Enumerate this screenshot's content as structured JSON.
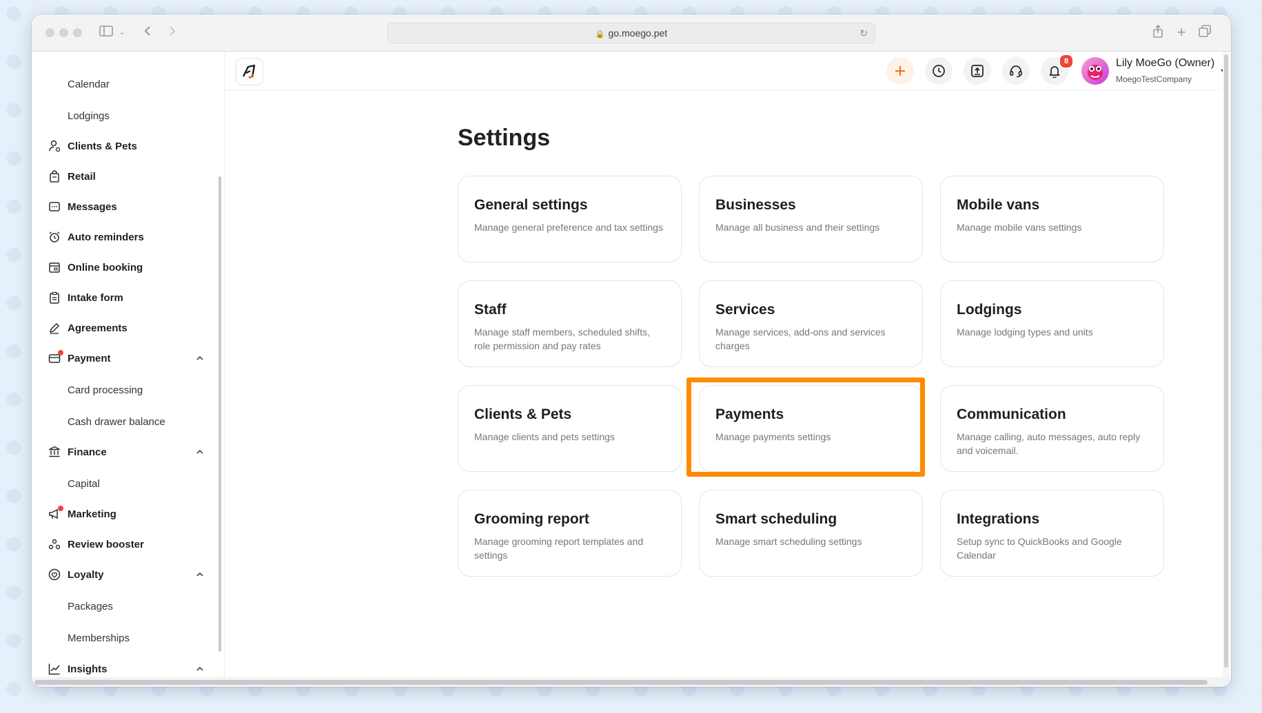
{
  "browser": {
    "url": "go.moego.pet"
  },
  "sidebar": {
    "items": [
      {
        "label": "Calendar",
        "sub": true
      },
      {
        "label": "Lodgings",
        "sub": true
      },
      {
        "label": "Clients & Pets",
        "icon": "user-icon"
      },
      {
        "label": "Retail",
        "icon": "bag-icon"
      },
      {
        "label": "Messages",
        "icon": "message-icon"
      },
      {
        "label": "Auto reminders",
        "icon": "alarm-clock-icon"
      },
      {
        "label": "Online booking",
        "icon": "calendar-booking-icon"
      },
      {
        "label": "Intake form",
        "icon": "clipboard-icon"
      },
      {
        "label": "Agreements",
        "icon": "pen-icon"
      },
      {
        "label": "Payment",
        "icon": "payment-icon",
        "expanded": true
      },
      {
        "label": "Card processing",
        "sub": true
      },
      {
        "label": "Cash drawer balance",
        "sub": true
      },
      {
        "label": "Finance",
        "icon": "bank-icon",
        "expanded": true
      },
      {
        "label": "Capital",
        "sub": true
      },
      {
        "label": "Marketing",
        "icon": "megaphone-icon"
      },
      {
        "label": "Review booster",
        "icon": "review-icon"
      },
      {
        "label": "Loyalty",
        "icon": "loyalty-icon",
        "expanded": true
      },
      {
        "label": "Packages",
        "sub": true
      },
      {
        "label": "Memberships",
        "sub": true
      },
      {
        "label": "Insights",
        "icon": "chart-icon",
        "expanded": true
      }
    ]
  },
  "header": {
    "notification_count": "8",
    "user_name": "Lily MoeGo (Owner)",
    "company": "MoegoTestCompany"
  },
  "page": {
    "title": "Settings",
    "cards": [
      {
        "title": "General settings",
        "desc": "Manage general preference and tax settings"
      },
      {
        "title": "Businesses",
        "desc": "Manage all business and their settings"
      },
      {
        "title": "Mobile vans",
        "desc": "Manage mobile vans settings"
      },
      {
        "title": "Staff",
        "desc": "Manage staff members, scheduled shifts, role permission and pay rates"
      },
      {
        "title": "Services",
        "desc": "Manage services, add-ons and services charges"
      },
      {
        "title": "Lodgings",
        "desc": "Manage lodging types and units"
      },
      {
        "title": "Clients & Pets",
        "desc": "Manage clients and pets settings"
      },
      {
        "title": "Payments",
        "desc": "Manage payments settings"
      },
      {
        "title": "Communication",
        "desc": "Manage calling, auto messages, auto reply and voicemail."
      },
      {
        "title": "Grooming report",
        "desc": "Manage grooming report templates and settings"
      },
      {
        "title": "Smart scheduling",
        "desc": "Manage smart scheduling settings"
      },
      {
        "title": "Integrations",
        "desc": "Setup sync to QuickBooks and Google Calendar"
      }
    ]
  },
  "colors": {
    "accent": "#f96b18",
    "highlight": "#ff8a00",
    "badge": "#f04438"
  }
}
